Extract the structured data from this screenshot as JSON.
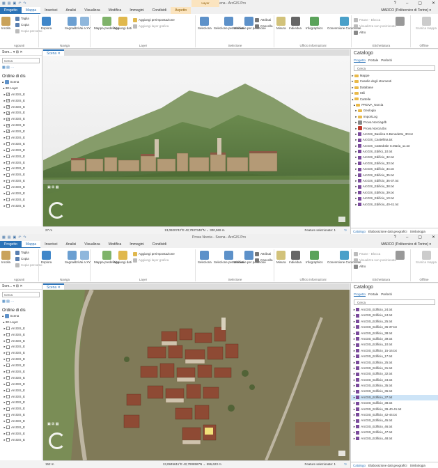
{
  "windows": [
    {
      "title": "Prova Norcia - Scena - ArcGIS Pro",
      "context_tab": "Layer",
      "tabs": [
        "Progetto",
        "Mappa",
        "Inserisci",
        "Analisi",
        "Visualizza",
        "Modifica",
        "Immagini",
        "Condividi",
        "Aspetto"
      ],
      "user": "MARCO (Politecnico di Torino) ▾",
      "ribbon": {
        "clipboard": {
          "taglia": "Taglia",
          "copia": "Copia",
          "incolla": "Incolla",
          "copia_percorso": "Copia percorso",
          "label": "Appunti"
        },
        "navigate": {
          "esplora": "Esplora",
          "segnalibri": "Segnalibri",
          "vai": "Vai a XY",
          "label": "Naviga"
        },
        "layer": {
          "mappa": "Mappa predefinita",
          "aggiungi": "Aggiungi dati",
          "preimpostazione": "Aggiungi preimpostazione",
          "grafica": "Aggiungi layer grafica",
          "label": "Layer"
        },
        "selection": {
          "seleziona": "Seleziona",
          "attributi": "Selezione per attributi",
          "posizione": "Selezione per posizione",
          "attributi2": "Attributi",
          "cancella": "Cancella",
          "label": "Selezione"
        },
        "inquire": {
          "misura": "Misura",
          "individua": "Individua",
          "infografica": "Infographics",
          "conversione": "Conversione Coordinate",
          "label": "Ufficio informazioni"
        },
        "labeling": {
          "pause": "Pause",
          "blocca": "Blocca",
          "visualizza": "Visualizza non posizionate",
          "altro": "Altro",
          "label": "Etichettatura"
        },
        "offline": {
          "scarica": "Scarica mappa",
          "convert": "Converti",
          "label": "Offline"
        }
      },
      "contents": {
        "title": "Som... ▾ ⊞ ✕",
        "search": "Cerca",
        "ordine": "Ordine di dis",
        "items": [
          "Scena",
          "3D Layer",
          "ArcGIS_E",
          "ArcGIS_E",
          "ArcGIS_E",
          "ArcGIS_E",
          "ArcGIS_E",
          "ArcGIS_E",
          "ArcGIS_E",
          "ArcGIS_E",
          "ArcGIS_E",
          "ArcGIS_E",
          "ArcGIS_E",
          "ArcGIS_E",
          "ArcGIS_E",
          "ArcGIS_E",
          "ArcGIS_E",
          "ArcGIS_E",
          "ArcGIS_E",
          "ArcGIS_E",
          "ArcGIS_E",
          "ArcGIS_E",
          "ArcGIS_E",
          "ArcGIS_E",
          "ArcGIS_E"
        ]
      },
      "map_tab": "Scena ✕",
      "status": {
        "scale": "27 m",
        "coords": "13,0920742°E 42,7937348°N ⌄ 300,969 m",
        "selected": "Feature selezionate: 1"
      },
      "catalog": {
        "title": "Catalogo",
        "tabs": [
          "Progetto",
          "Portale",
          "Preferiti"
        ],
        "search": "Cerca",
        "items": [
          "Mappe",
          "Caselle degli strumenti",
          "Database",
          "Stili",
          "Cartelle",
          "PROVA_Norcia",
          "Geologia",
          "ImportLog",
          "Prova Norciagdb",
          "Prova Norcia.tbx",
          "ArcGIS_Basilica S.Benedetto_30.txt",
          "ArcGIS_Castellina.txt",
          "ArcGIS_Cattedrale S.Maria_11.txt",
          "ArcGIS_Edifici_10.txt",
          "ArcGIS_Edificio_32.txt",
          "ArcGIS_Edificio_33.txt",
          "ArcGIS_Edificio_34.txt",
          "ArcGIS_Edificio_35.txt",
          "ArcGIS_Edificio_36-37.txt",
          "ArcGIS_Edificio_38.txt",
          "ArcGIS_Edificio_39.txt",
          "ArcGIS_Edificio_10.txt",
          "ArcGIS_Edificio_40-41.txt"
        ],
        "bottom": [
          "Catalogo",
          "Elaborazione dati geografici",
          "Simbologia"
        ]
      }
    },
    {
      "title": "Prova Norcia - Scena - ArcGIS Pro",
      "context_tab": "",
      "tabs": [
        "Progetto",
        "Mappa",
        "Inserisci",
        "Analisi",
        "Visualizza",
        "Modifica",
        "Immagini",
        "Condividi"
      ],
      "user": "MARCO (Politecnico di Torino) ▾",
      "contents": {
        "title": "Som... ▾ ⊞ ✕",
        "search": "Cerca",
        "ordine": "Ordine di dis",
        "items": [
          "Scena",
          "3D Layer",
          "ArcGIS_E",
          "ArcGIS_E",
          "ArcGIS_E",
          "ArcGIS_E",
          "ArcGIS_E",
          "ArcGIS_E",
          "ArcGIS_E",
          "ArcGIS_E",
          "ArcGIS_E",
          "ArcGIS_E",
          "ArcGIS_E",
          "ArcGIS_E",
          "ArcGIS_E",
          "ArcGIS_E",
          "ArcGIS_E",
          "ArcGIS_E",
          "ArcGIS_E",
          "ArcGIS_E",
          "ArcGIS_E",
          "ArcGIS_E",
          "ArcGIS_E",
          "ArcGIS_E",
          "ArcGIS_E"
        ]
      },
      "map_tab": "Scena ✕",
      "status": {
        "scale": "152 m",
        "coords": "13,0845611°E 42,7908587N ⌄ 596,623 m",
        "selected": "Feature selezionate: 1"
      },
      "catalog": {
        "title": "Catalogo",
        "tabs": [
          "Progetto",
          "Portale",
          "Preferiti"
        ],
        "search": "Cerca",
        "items": [
          "ArcGIS_Edificio_24.txt",
          "ArcGIS_Edificio_24.txt",
          "ArcGIS_Edificio_25.txt",
          "ArcGIS_Edificio_36-37.txt",
          "ArcGIS_Edificio_38.txt",
          "ArcGIS_Edificio_39.txt",
          "ArcGIS_Edificio_10.txt",
          "ArcGIS_Edificio_15-16.txt",
          "ArcGIS_Edificio_17.txt",
          "ArcGIS_Edificio_25.txt",
          "ArcGIS_Edificio_31.txt",
          "ArcGIS_Edificio_32.txt",
          "ArcGIS_Edificio_34.txt",
          "ArcGIS_Edificio_35.txt",
          "ArcGIS_Edificio_36.txt",
          "ArcGIS_Edificio_37.txt",
          "ArcGIS_Edificio_38.txt",
          "ArcGIS_Edificio_39-40-41.txt",
          "ArcGIS_Edificio_42-44.txt",
          "ArcGIS_Edificio_45.txt",
          "ArcGIS_Edificio_46.txt",
          "ArcGIS_Edificio_47.txt",
          "ArcGIS_Edificio_48.txt"
        ],
        "bottom": [
          "Catalogo",
          "Elaborazione dati geografici",
          "Simbologia"
        ]
      }
    }
  ],
  "colors": {
    "accent": "#2b73b8",
    "project_tab": "#2b73b8",
    "context": "#fbe4bf"
  }
}
